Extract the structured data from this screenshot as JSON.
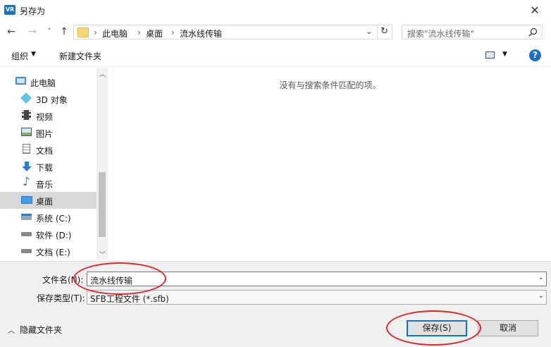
{
  "window": {
    "title": "另存为",
    "app_badge": "VR",
    "close_glyph": "✕"
  },
  "nav": {
    "back": "←",
    "forward": "→",
    "recent": "˅",
    "up": "↑",
    "refresh": "↻"
  },
  "address": {
    "crumbs": [
      "此电脑",
      "桌面",
      "流水线传输"
    ],
    "sep": "›"
  },
  "search": {
    "placeholder": "搜索\"流水线传输\""
  },
  "toolbar": {
    "organize": "组织",
    "new_folder": "新建文件夹",
    "help": "?"
  },
  "sidebar": {
    "items": [
      {
        "label": "此电脑",
        "icon": "computer-icon"
      },
      {
        "label": "3D 对象",
        "icon": "3d-objects-icon"
      },
      {
        "label": "视频",
        "icon": "video-icon"
      },
      {
        "label": "图片",
        "icon": "picture-icon"
      },
      {
        "label": "文档",
        "icon": "document-icon"
      },
      {
        "label": "下载",
        "icon": "download-icon"
      },
      {
        "label": "音乐",
        "icon": "music-icon"
      },
      {
        "label": "桌面",
        "icon": "desktop-icon",
        "selected": true
      },
      {
        "label": "系统 (C:)",
        "icon": "drive-c-icon"
      },
      {
        "label": "软件 (D:)",
        "icon": "drive-d-icon"
      },
      {
        "label": "文档 (E:)",
        "icon": "drive-e-icon"
      }
    ]
  },
  "main": {
    "empty_message": "没有与搜索条件匹配的项。"
  },
  "form": {
    "filename_label": "文件名(N):",
    "filename_value": "流水线传输",
    "filetype_label": "保存类型(T):",
    "filetype_value": "SFB工程文件 (*.sfb)",
    "hide_folders": "隐藏文件夹",
    "save": "保存(S)",
    "cancel": "取消"
  },
  "colors": {
    "accent": "#1c6fc7",
    "annotation": "#e0262a",
    "selected_bg": "#cce8ff"
  }
}
